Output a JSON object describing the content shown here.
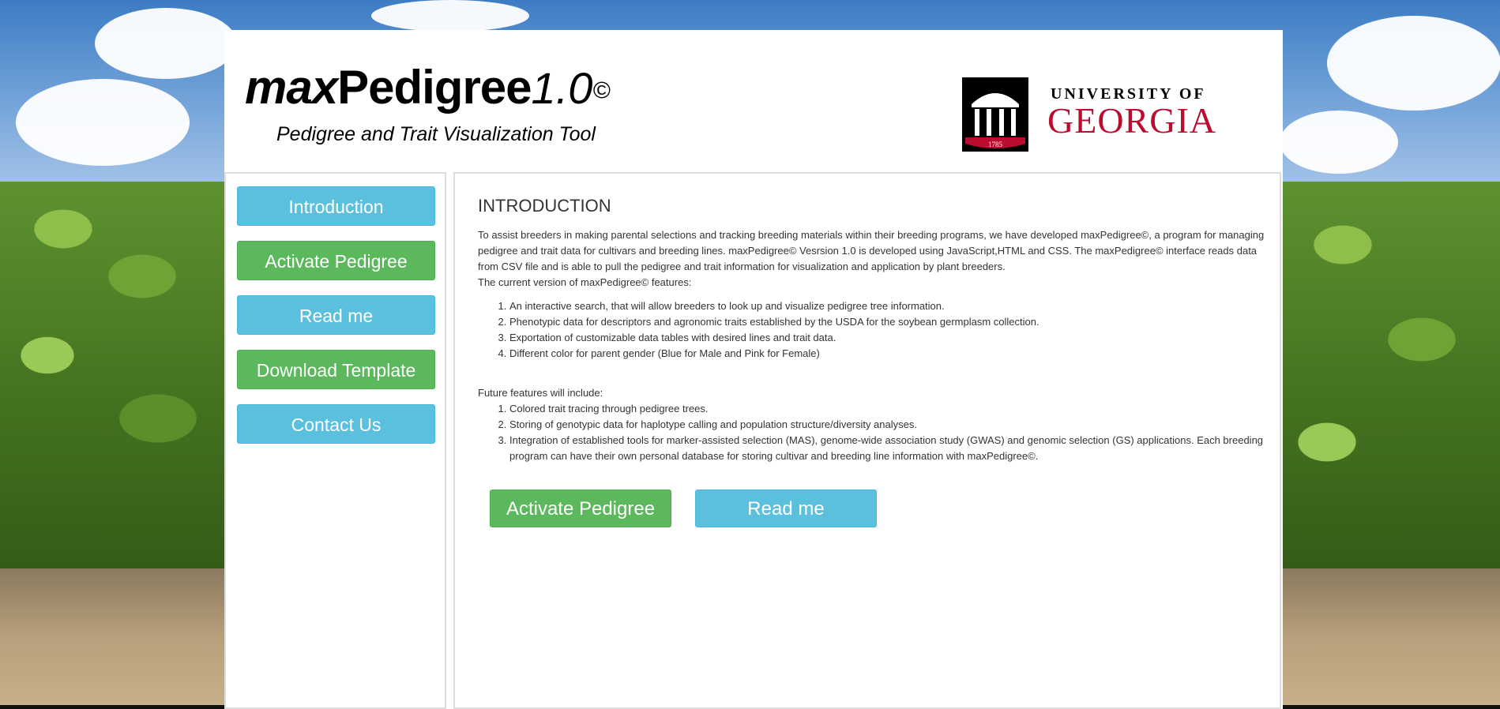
{
  "header": {
    "title_max": "max",
    "title_pedigree": "Pedigree",
    "title_version": "1.0",
    "title_copyright": "©",
    "subtitle": "Pedigree and Trait Visualization Tool",
    "uga_line1": "UNIVERSITY OF",
    "uga_line2": "GEORGIA",
    "uga_year": "1785",
    "brand_color": "#ba0c2f"
  },
  "sidebar": {
    "items": [
      {
        "label": "Introduction",
        "color": "#5bc0de"
      },
      {
        "label": "Activate Pedigree",
        "color": "#5cb85c"
      },
      {
        "label": "Read me",
        "color": "#5bc0de"
      },
      {
        "label": "Download Template",
        "color": "#5cb85c"
      },
      {
        "label": "Contact Us",
        "color": "#5bc0de"
      }
    ]
  },
  "main": {
    "title": "INTRODUCTION",
    "intro": "To assist breeders in making parental selections and tracking breeding materials within their breeding programs, we have developed maxPedigree©, a program for managing pedigree and trait data for cultivars and breeding lines. maxPedigree© Vesrsion 1.0 is developed using JavaScript,HTML and CSS. The maxPedigree© interface reads data from CSV file and is able to pull the pedigree and trait information for visualization and application by plant breeders.",
    "features_heading": "The current version of maxPedigree© features:",
    "features": [
      "An interactive search, that will allow breeders to look up and visualize pedigree tree information.",
      "Phenotypic data for descriptors and agronomic traits established by the USDA for the soybean germplasm collection.",
      "Exportation of customizable data tables with desired lines and trait data.",
      "Different color for parent gender (Blue for Male and Pink for Female)"
    ],
    "future_heading": "Future features will include:",
    "future": [
      "Colored trait tracing through pedigree trees.",
      "Storing of genotypic data for haplotype calling and population structure/diversity analyses.",
      "Integration of established tools for marker-assisted selection (MAS), genome-wide association study (GWAS) and genomic selection (GS) applications. Each breeding program can have their own personal database for storing cultivar and breeding line information with maxPedigree©."
    ],
    "activate_label": "Activate Pedigree",
    "readme_label": "Read me"
  }
}
